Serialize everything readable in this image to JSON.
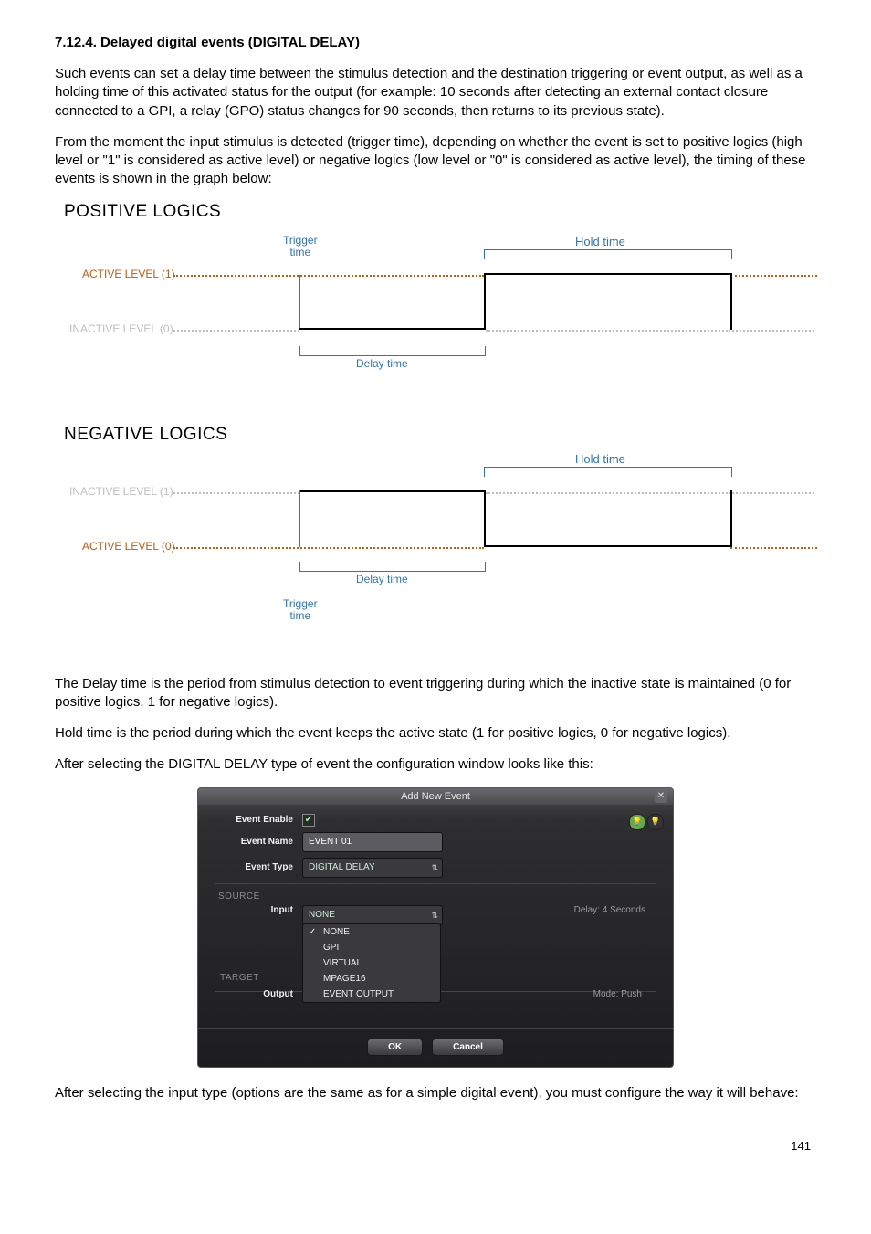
{
  "heading": "7.12.4. Delayed digital events (DIGITAL DELAY)",
  "para1": "Such events can set a delay time between the stimulus detection and the destination triggering or event output, as well as a holding time of this activated status for the output (for example: 10 seconds after detecting an external contact closure connected to a GPI, a relay (GPO) status changes for 90 seconds, then returns to its previous state).",
  "para2": "From the moment the input stimulus is detected (trigger time), depending on whether the event is set to positive logics (high level or \"1\" is considered as active level) or negative logics (low level or \"0\" is considered as active level), the timing of these events is shown in the graph below:",
  "positive": {
    "title": "POSITIVE LOGICS",
    "active_label": "ACTIVE LEVEL (1)",
    "inactive_label": "INACTIVE LEVEL (0)",
    "trigger_label": "Trigger\ntime",
    "delay_label": "Delay time",
    "hold_label": "Hold time"
  },
  "negative": {
    "title": "NEGATIVE LOGICS",
    "inactive_label": "INACTIVE LEVEL (1)",
    "active_label": "ACTIVE LEVEL (0)",
    "trigger_label": "Trigger\ntime",
    "delay_label": "Delay time",
    "hold_label": "Hold time"
  },
  "para3a": "The Delay time is the period from stimulus detection to event triggering during which the inactive state is maintained (0 for positive logics, 1 for negative logics).",
  "para3b": "Hold time is the period during which the event keeps the active state (1 for positive logics, 0 for negative logics).",
  "para4": "After selecting the DIGITAL DELAY type of event the configuration window looks like this:",
  "dialog": {
    "title": "Add New Event",
    "enable_label": "Event Enable",
    "name_label": "Event Name",
    "name_value": "EVENT 01",
    "type_label": "Event Type",
    "type_value": "DIGITAL DELAY",
    "source_section": "SOURCE",
    "input_label": "Input",
    "input_value": "NONE",
    "delay_text": "Delay: 4 Seconds",
    "dropdown": {
      "o1": "NONE",
      "o2": "GPI",
      "o3": "VIRTUAL",
      "o4": "MPAGE16",
      "o5": "EVENT OUTPUT"
    },
    "target_section": "TARGET",
    "output_label": "Output",
    "mode_text": "Mode: Push",
    "ok": "OK",
    "cancel": "Cancel"
  },
  "para5": "After selecting the input type (options are the same as for a simple digital event), you must configure the way it will behave:",
  "page_number": "141"
}
